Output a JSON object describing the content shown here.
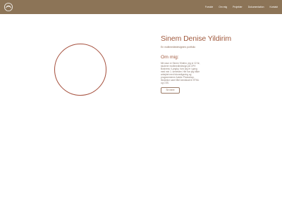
{
  "nav": {
    "items": [
      "Forside",
      "Om mig",
      "Projekter",
      "Dokumentation",
      "Kontakt"
    ]
  },
  "hero": {
    "name": "Sinem Denise Yildirim",
    "subtitle": "En multimediedesigners portfolio",
    "about_heading": "Om mig:",
    "about_text": "Mit navn er Sinem Yildirim, jeg er 22 år, studerer multimediedesign på CPH Business i Lyngby, hvor jeg er i gang med min 1. semester. Her har jeg både arbejdet med fotoredigering og programmerne Adobe Photoshop, Illustrator samt fået kendskab til HTML og CSS.",
    "more_button": "Se mere"
  },
  "colors": {
    "navbar": "#8c7457",
    "accent": "#a15a3e",
    "portrait_border": "#a54f3c"
  },
  "icons": {
    "logo": "circular-swirl-logo"
  }
}
